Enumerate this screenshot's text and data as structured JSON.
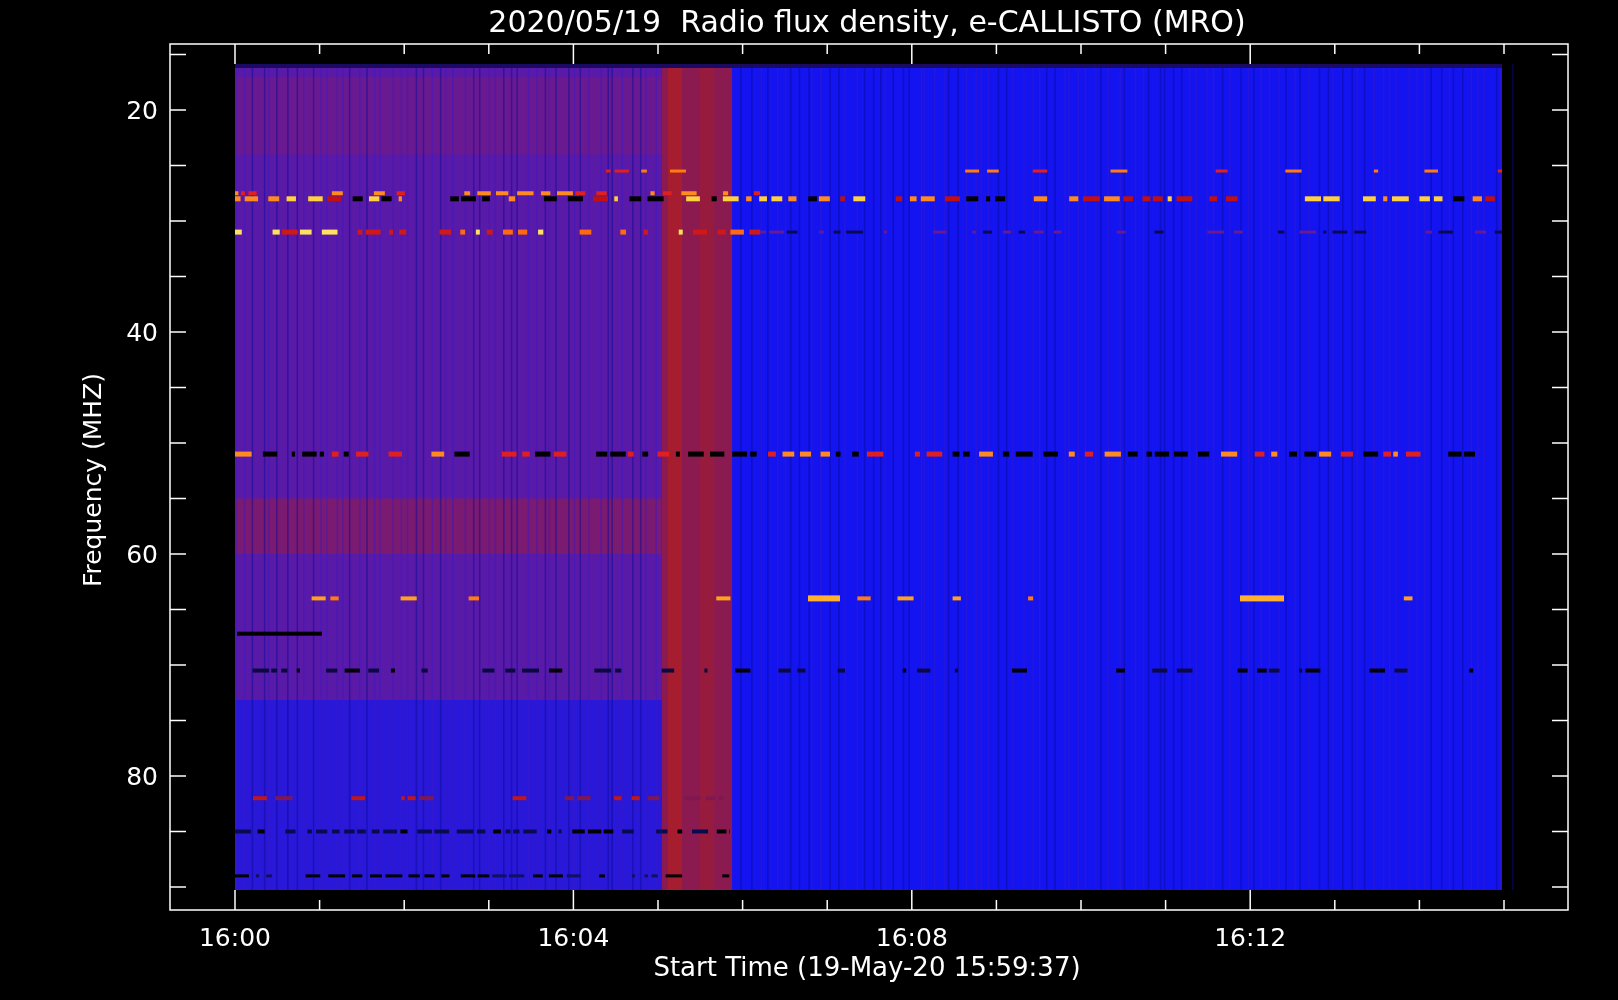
{
  "title": "2020/05/19  Radio flux density, e-CALLISTO (MRO)",
  "y_axis": {
    "label": "Frequency (MHZ)",
    "ticks": [
      "20",
      "40",
      "60",
      "80"
    ]
  },
  "x_axis": {
    "label": "Start Time (19-May-20 15:59:37)",
    "ticks": [
      "16:00",
      "16:04",
      "16:08",
      "16:12"
    ]
  }
}
